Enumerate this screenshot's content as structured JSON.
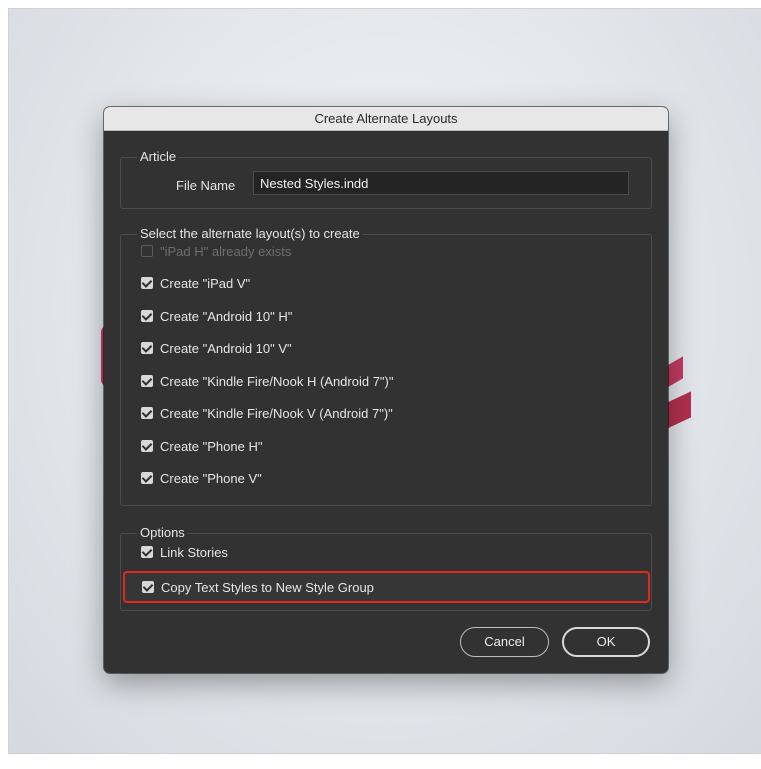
{
  "dialog": {
    "title": "Create Alternate Layouts",
    "article": {
      "legend": "Article",
      "file_name_label": "File Name",
      "file_name_value": "Nested Styles.indd"
    },
    "layouts": {
      "legend": "Select the alternate layout(s) to create",
      "items": [
        {
          "label": "\"iPad H\" already exists",
          "checked": false,
          "disabled": true
        },
        {
          "label": "Create \"iPad V\"",
          "checked": true,
          "disabled": false
        },
        {
          "label": "Create \"Android 10\" H\"",
          "checked": true,
          "disabled": false
        },
        {
          "label": "Create \"Android 10\" V\"",
          "checked": true,
          "disabled": false
        },
        {
          "label": "Create \"Kindle Fire/Nook H (Android 7\")\"",
          "checked": true,
          "disabled": false
        },
        {
          "label": "Create \"Kindle Fire/Nook V (Android 7\")\"",
          "checked": true,
          "disabled": false
        },
        {
          "label": "Create \"Phone H\"",
          "checked": true,
          "disabled": false
        },
        {
          "label": "Create \"Phone V\"",
          "checked": true,
          "disabled": false
        }
      ]
    },
    "options": {
      "legend": "Options",
      "link_stories": "Link Stories",
      "copy_text_styles": "Copy Text Styles to New Style Group"
    },
    "buttons": {
      "cancel": "Cancel",
      "ok": "OK"
    }
  },
  "colors": {
    "dialog_bg": "#323232",
    "highlight_border": "#e02a1d",
    "titlebar_bg": "#e7e7e7"
  }
}
